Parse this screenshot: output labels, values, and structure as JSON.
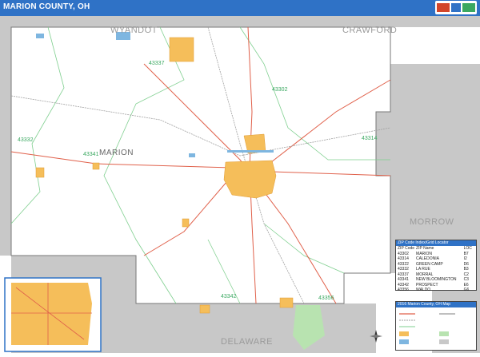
{
  "title": "MARION COUNTY, OH",
  "colors": {
    "title_bar": "#2f72c6",
    "urban_area": "#f5be5a",
    "outside_county": "#c8c8c8",
    "road_major": "#e0604a",
    "rail": "#a0a0a0",
    "zip_boundary": "#7fcf8f",
    "water": "#7eb6e0",
    "park": "#b8e3b0"
  },
  "icons": {
    "publisher_logo": "map-publisher-logo-icon",
    "compass": "north-arrow-icon"
  },
  "counties": {
    "wyandot": "WYANDOT",
    "crawford": "CRAWFORD",
    "morrow": "MORROW",
    "delaware": "DELAWARE",
    "marion": "MARION"
  },
  "zip_labels": [
    "43337",
    "43302",
    "43332",
    "43341",
    "43314",
    "43342",
    "43356"
  ],
  "zip_index": {
    "title": "ZIP Code Index/Grid Locator",
    "headers": [
      "ZIP Code",
      "ZIP Name",
      "LOC"
    ],
    "rows": [
      [
        "43302",
        "MARION",
        "B7"
      ],
      [
        "43314",
        "CALEDONIA",
        "I2"
      ],
      [
        "43322",
        "GREEN CAMP",
        "D6"
      ],
      [
        "43332",
        "LA RUE",
        "B3"
      ],
      [
        "43337",
        "MORRAL",
        "C2"
      ],
      [
        "43341",
        "NEW BLOOMINGTON",
        "C3"
      ],
      [
        "43342",
        "PROSPECT",
        "E6"
      ],
      [
        "43356",
        "WALDO",
        "G6"
      ]
    ]
  },
  "legend": {
    "title": "2016 Marion County, OH Map"
  }
}
